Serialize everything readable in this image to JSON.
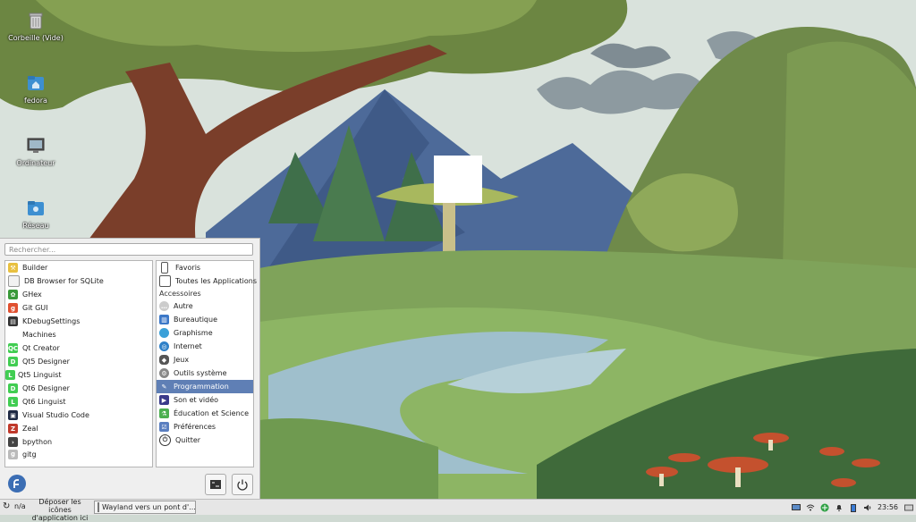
{
  "desktop": {
    "icons": [
      {
        "label": "Corbeille (Vide)",
        "icon": "trash-icon"
      },
      {
        "label": "fedora",
        "icon": "home-folder-icon"
      },
      {
        "label": "Ordinateur",
        "icon": "computer-icon"
      },
      {
        "label": "Réseau",
        "icon": "network-icon"
      }
    ]
  },
  "menu": {
    "search_placeholder": "Rechercher...",
    "apps": [
      {
        "label": "Builder",
        "icon": "builder-icon"
      },
      {
        "label": "DB Browser for SQLite",
        "icon": "db-browser-icon"
      },
      {
        "label": "GHex",
        "icon": "ghex-icon"
      },
      {
        "label": "Git GUI",
        "icon": "git-gui-icon"
      },
      {
        "label": "KDebugSettings",
        "icon": "kdebugsettings-icon"
      },
      {
        "label": "Machines",
        "icon": "machines-icon"
      },
      {
        "label": "Qt Creator",
        "icon": "qt-creator-icon"
      },
      {
        "label": "Qt5 Designer",
        "icon": "qt5-designer-icon"
      },
      {
        "label": "Qt5 Linguist",
        "icon": "qt5-linguist-icon"
      },
      {
        "label": "Qt6 Designer",
        "icon": "qt6-designer-icon"
      },
      {
        "label": "Qt6 Linguist",
        "icon": "qt6-linguist-icon"
      },
      {
        "label": "Visual Studio Code",
        "icon": "vscode-icon"
      },
      {
        "label": "Zeal",
        "icon": "zeal-icon"
      },
      {
        "label": "bpython",
        "icon": "bpython-icon"
      },
      {
        "label": "gitg",
        "icon": "gitg-icon"
      }
    ],
    "favorites_label": "Favoris",
    "all_apps_label": "Toutes les Applications",
    "section_heading": "Accessoires",
    "categories": [
      {
        "label": "Autre",
        "icon": "other-icon"
      },
      {
        "label": "Bureautique",
        "icon": "office-icon"
      },
      {
        "label": "Graphisme",
        "icon": "graphics-icon"
      },
      {
        "label": "Internet",
        "icon": "internet-icon"
      },
      {
        "label": "Jeux",
        "icon": "games-icon"
      },
      {
        "label": "Outils système",
        "icon": "system-tools-icon"
      },
      {
        "label": "Programmation",
        "icon": "programming-icon",
        "selected": true
      },
      {
        "label": "Son et vidéo",
        "icon": "multimedia-icon"
      },
      {
        "label": "Éducation et Science",
        "icon": "education-icon"
      },
      {
        "label": "Préférences",
        "icon": "settings-icon"
      },
      {
        "label": "Quitter",
        "icon": "power-icon"
      }
    ]
  },
  "taskbar": {
    "workspace_text": "n/a",
    "launcher_hint_line1": "Déposer les icônes",
    "launcher_hint_line2": "d'application ici",
    "task_title": "Wayland vers un pont d'...",
    "clock": "23:56"
  },
  "colors": {
    "selection": "#5f7fb5",
    "fedora_blue": "#3c6eb4"
  }
}
